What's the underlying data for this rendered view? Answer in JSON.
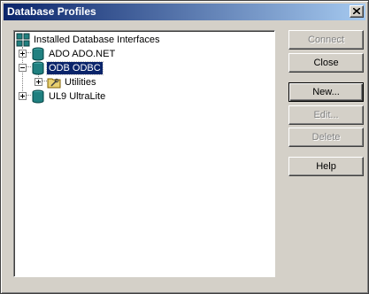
{
  "window": {
    "title": "Database Profiles"
  },
  "tree": {
    "root": {
      "label": "Installed Database Interfaces",
      "icon": "database-interfaces-icon"
    },
    "items": [
      {
        "label": "ADO ADO.NET",
        "expander": "+",
        "icon": "database-icon"
      },
      {
        "label": "ODB ODBC",
        "expander": "-",
        "icon": "database-icon",
        "selected": true
      },
      {
        "label": "Utilities",
        "expander": "+",
        "icon": "utilities-folder-icon"
      },
      {
        "label": "UL9 UltraLite",
        "expander": "+",
        "icon": "database-icon"
      }
    ]
  },
  "buttons": {
    "connect": {
      "label": "Connect",
      "enabled": false
    },
    "close": {
      "label": "Close",
      "enabled": true
    },
    "new": {
      "label": "New...",
      "enabled": true
    },
    "edit": {
      "label": "Edit...",
      "enabled": false
    },
    "delete": {
      "label": "Delete",
      "enabled": false
    },
    "help": {
      "label": "Help",
      "enabled": true
    }
  }
}
